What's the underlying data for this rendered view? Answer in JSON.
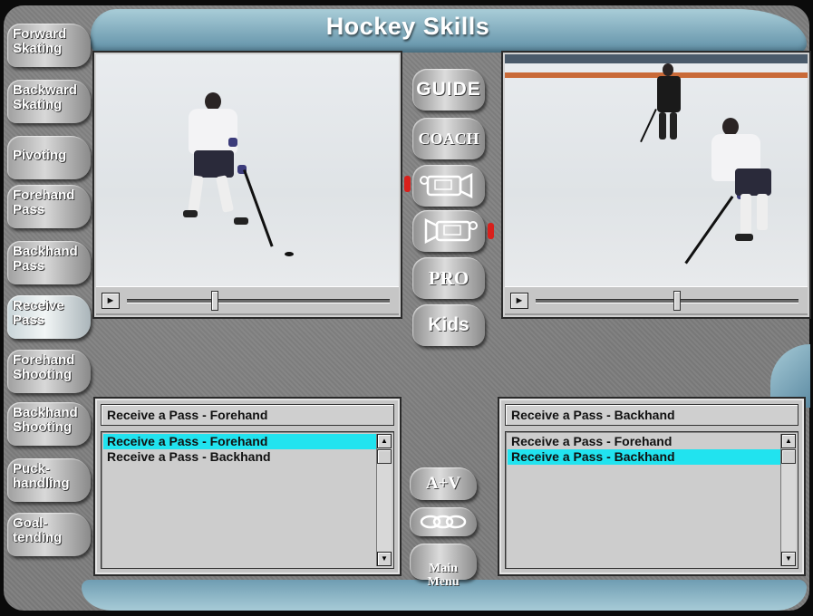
{
  "app": {
    "title": "Hockey Skills"
  },
  "sidebar": {
    "items": [
      {
        "label": "Forward\nSkating"
      },
      {
        "label": "Backward\nSkating"
      },
      {
        "label": "Pivoting"
      },
      {
        "label": "Forehand\nPass"
      },
      {
        "label": "Backhand\nPass"
      },
      {
        "label": "Receive\nPass",
        "active": true
      },
      {
        "label": "Forehand\nShooting"
      },
      {
        "label": "Backhand\nShooting"
      },
      {
        "label": "Puck-\nhandling"
      },
      {
        "label": "Goal-\ntending"
      }
    ]
  },
  "center": {
    "guide_label": "GUIDE",
    "coach_label": "COACH",
    "video_left_icon": "video-camera-left-icon",
    "video_right_icon": "video-camera-right-icon",
    "pro_label": "PRO",
    "kids_label": "Kids",
    "av_label": "A+V",
    "link_icon": "chain-link-icon",
    "main_menu_label": "Main\nMenu"
  },
  "left_player": {
    "play_symbol": "►",
    "progress": 0.33
  },
  "right_player": {
    "play_symbol": "►",
    "progress": 0.54
  },
  "left_list": {
    "header": "Receive a Pass - Forehand",
    "items": [
      "Receive a Pass - Forehand",
      "Receive a Pass - Backhand"
    ],
    "selected_index": 0
  },
  "right_list": {
    "header": "Receive a Pass - Backhand",
    "items": [
      "Receive a Pass - Forehand",
      "Receive a Pass - Backhand"
    ],
    "selected_index": 1
  },
  "scroll": {
    "up": "▲",
    "down": "▼"
  },
  "colors": {
    "selection": "#21e3ef",
    "indicator": "#d8201c",
    "accent_wave": "#8fb8c8"
  }
}
